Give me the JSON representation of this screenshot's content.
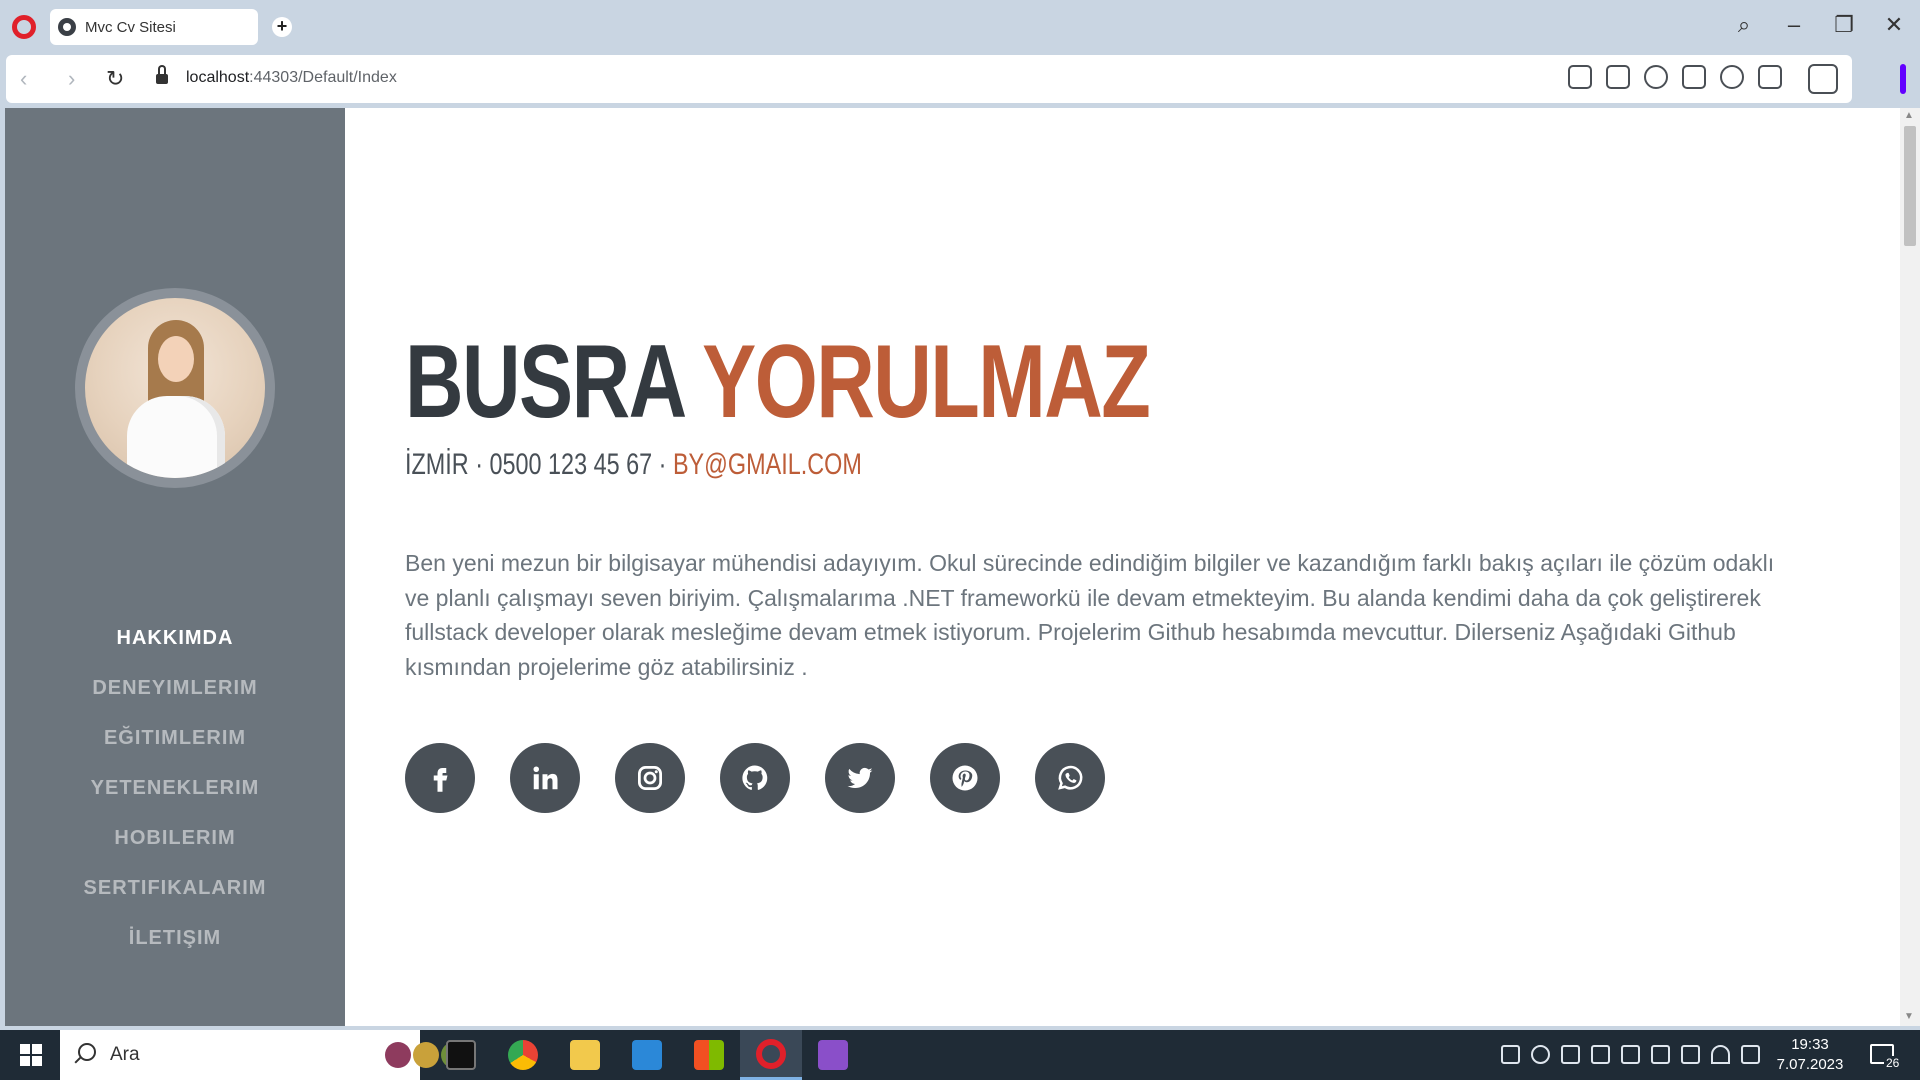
{
  "browser": {
    "tab_title": "Mvc Cv Sitesi",
    "url_host": "localhost",
    "url_path": ":44303/Default/Index"
  },
  "site": {
    "first_name": "BUSRA",
    "last_name": "YORULMAZ",
    "location": "İZMİR · 0500 123 45 67 ·",
    "email": "BY@GMAIL.COM",
    "about": "Ben yeni mezun bir bilgisayar mühendisi adayıyım. Okul sürecinde edindiğim bilgiler ve kazandığım farklı bakış açıları ile çözüm odaklı ve planlı çalışmayı seven biriyim. Çalışmalarıma .NET frameworkü ile devam etmekteyim. Bu alanda kendimi daha da çok geliştirerek fullstack developer olarak mesleğime devam etmek istiyorum. Projelerim Github hesabımda mevcuttur. Dilerseniz Aşağıdaki Github kısmından projelerime göz atabilirsiniz .",
    "nav": [
      {
        "label": "HAKKIMDA",
        "active": true
      },
      {
        "label": "DENEYIMLERIM",
        "active": false
      },
      {
        "label": "EĞITIMLERIM",
        "active": false
      },
      {
        "label": "YETENEKLERIM",
        "active": false
      },
      {
        "label": "HOBILERIM",
        "active": false
      },
      {
        "label": "SERTIFIKALARIM",
        "active": false
      },
      {
        "label": "İLETIŞIM",
        "active": false
      }
    ],
    "socials": [
      "facebook-icon",
      "linkedin-icon",
      "instagram-icon",
      "github-icon",
      "twitter-icon",
      "pinterest-icon",
      "whatsapp-icon"
    ],
    "colors": {
      "sidebar": "#6c757d",
      "accent": "#bd5d38",
      "dark": "#343a40",
      "social_bg": "#495057"
    }
  },
  "taskbar": {
    "search_placeholder": "Ara",
    "time": "19:33",
    "date": "7.07.2023",
    "notification_count": "26"
  }
}
